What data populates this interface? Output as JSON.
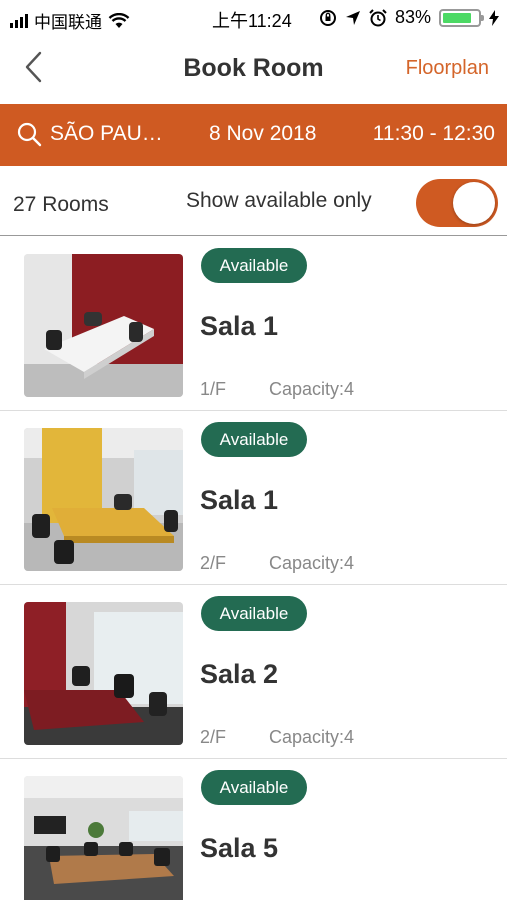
{
  "status_bar": {
    "carrier": "中国联通",
    "time": "上午11:24",
    "battery": "83%",
    "battery_level": 0.83
  },
  "nav": {
    "title": "Book Room",
    "floorplan_label": "Floorplan"
  },
  "search": {
    "location": "SÃO PAU…",
    "date": "8 Nov 2018",
    "time_range": "11:30 - 12:30"
  },
  "filter": {
    "room_count": "27 Rooms",
    "show_available_label": "Show available only",
    "show_available_on": true
  },
  "rooms": [
    {
      "status": "Available",
      "name": "Sala 1",
      "floor": "1/F",
      "capacity": "Capacity:4"
    },
    {
      "status": "Available",
      "name": "Sala 1",
      "floor": "2/F",
      "capacity": "Capacity:4"
    },
    {
      "status": "Available",
      "name": "Sala 2",
      "floor": "2/F",
      "capacity": "Capacity:4"
    },
    {
      "status": "Available",
      "name": "Sala 5"
    }
  ],
  "colors": {
    "accent": "#cf5a22",
    "available_badge": "#236b52"
  }
}
